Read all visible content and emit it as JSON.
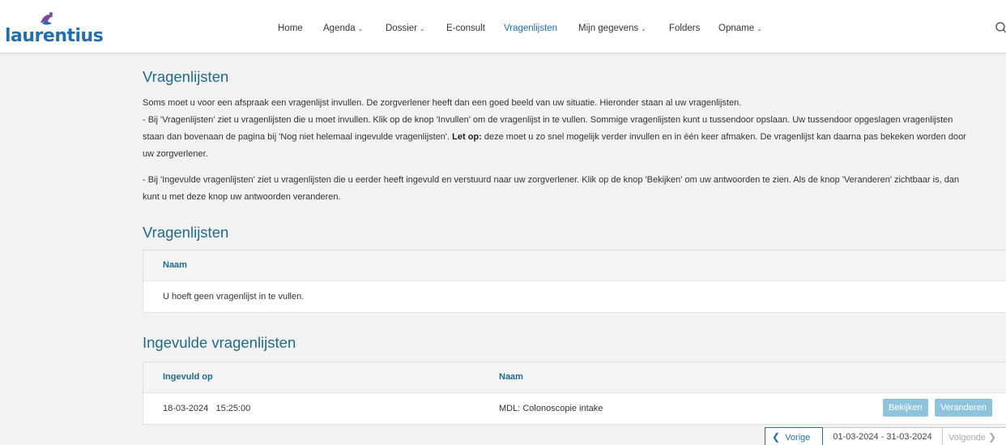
{
  "brand": {
    "logo_text": "laurentius"
  },
  "nav": {
    "items": [
      {
        "label": "Home",
        "dropdown": false,
        "active": false
      },
      {
        "label": "Agenda",
        "dropdown": true,
        "active": false
      },
      {
        "label": "Dossier",
        "dropdown": true,
        "active": false
      },
      {
        "label": "E-consult",
        "dropdown": false,
        "active": false
      },
      {
        "label": "Vragenlijsten",
        "dropdown": false,
        "active": true
      },
      {
        "label": "Mijn gegevens",
        "dropdown": true,
        "active": false
      },
      {
        "label": "Folders",
        "dropdown": false,
        "active": false
      },
      {
        "label": "Opname",
        "dropdown": true,
        "active": false
      }
    ],
    "search_icon": "search-icon"
  },
  "page": {
    "title": "Vragenlijsten",
    "intro": "Soms moet u voor een afspraak een vragenlijst invullen. De zorgverlener heeft dan een goed beeld van uw situatie. Hieronder staan al uw vragenlijsten.",
    "p1_line1": "- Bij 'Vragenlijsten' ziet u vragenlijsten die u moet invullen. Klik op de knop 'Invullen' om de vragenlijst in te vullen. Sommige vragenlijsten kunt u tussendoor opslaan. Uw tussendoor opgeslagen vragenlijsten",
    "p1_line2_a": "staan dan bovenaan de pagina bij 'Nog niet helemaal ingevulde vragenlijsten'.",
    "p1_line2_bold": "Let op:",
    "p1_line2_b": "deze moet u zo snel mogelijk verder invullen en in één keer afmaken. De vragenlijst kan daarna pas bekeken worden door",
    "p1_line3": "uw zorgverlener.",
    "p2_line1": "- Bij 'Ingevulde vragenlijsten' ziet u vragenlijsten die u eerder heeft ingevuld en verstuurd naar uw zorgverlener. Klik op de knop 'Bekijken' om uw antwoorden te zien. Als de knop 'Veranderen' zichtbaar is, dan",
    "p2_line2": "kunt u met deze knop uw antwoorden veranderen."
  },
  "open_list": {
    "title": "Vragenlijsten",
    "header_name": "Naam",
    "empty_message": "U hoeft geen vragenlijst in te vullen."
  },
  "completed_list": {
    "title": "Ingevulde vragenlijsten",
    "header_date": "Ingevuld op",
    "header_name": "Naam",
    "rows": [
      {
        "date": "18-03-2024",
        "time": "15:25:00",
        "name": "MDL: Colonoscopie intake",
        "view_label": "Bekijken",
        "edit_label": "Veranderen"
      }
    ]
  },
  "pager": {
    "prev_label": "Vorige",
    "range": "01-03-2024 - 31-03-2024",
    "next_label": "Volgende"
  }
}
